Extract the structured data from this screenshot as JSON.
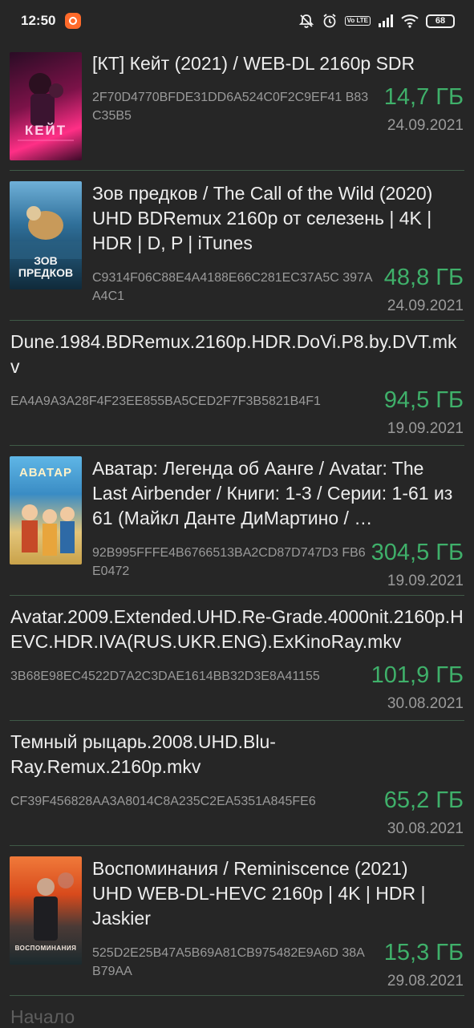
{
  "status": {
    "time": "12:50",
    "battery": "68",
    "volte": "Vo LTE"
  },
  "colors": {
    "size": "#3fb06a",
    "background": "#262626",
    "separator": "#3f5a47"
  },
  "items": [
    {
      "title": "[КТ] Кейт (2021) / WEB-DL 2160p SDR",
      "hash": "2F70D4770BFDE31DD6A524C0F2C9EF41 B83C35B5",
      "size": "14,7 ГБ",
      "date": "24.09.2021",
      "poster_text": "КЕЙТ",
      "poster_colors": [
        "#ff2f86",
        "#3a0a28"
      ]
    },
    {
      "title": "Зов предков / The Call of the Wild (2020) UHD BDRemux 2160p от селезень | 4K | HDR | D, P | iTunes",
      "hash": "C9314F06C88E4A4188E66C281EC37A5C 397AA4C1",
      "size": "48,8 ГБ",
      "date": "24.09.2021",
      "poster_text": "ЗОВ ПРЕДКОВ",
      "poster_colors": [
        "#3f84b6",
        "#102a3a"
      ]
    },
    {
      "title": "Dune.1984.BDRemux.2160p.HDR.DoVi.P8.by.DVT.mkv",
      "hash": "EA4A9A3A28F4F23EE855BA5CED2F7F3B5821B4F1",
      "size": "94,5 ГБ",
      "date": "19.09.2021"
    },
    {
      "title": "Аватар: Легенда об Аанге / Avatar: The Last Airbender / Книги: 1-3 / Серии: 1-61 из 61 (Майкл Данте ДиМартино / …",
      "hash": "92B995FFFE4B6766513BA2CD87D747D3 FB6E0472",
      "size": "304,5 ГБ",
      "date": "19.09.2021",
      "poster_text": "АВАТАР",
      "poster_colors": [
        "#3a8cc4",
        "#c9a24a"
      ]
    },
    {
      "title": "Avatar.2009.Extended.UHD.Re-Grade.4000nit.2160p.HEVC.HDR.IVA(RUS.UKR.ENG).ExKinoRay.mkv",
      "hash": "3B68E98EC4522D7A2C3DAE1614BB32D3E8A41155",
      "size": "101,9 ГБ",
      "date": "30.08.2021"
    },
    {
      "title": "Темный рыцарь.2008.UHD.Blu-Ray.Remux.2160p.mkv",
      "hash": "CF39F456828AA3A8014C8A235C2EA5351A845FE6",
      "size": "65,2 ГБ",
      "date": "30.08.2021"
    },
    {
      "title": "Воспоминания / Reminiscence (2021) UHD WEB-DL-HEVC 2160p | 4K | HDR | Jaskier",
      "hash": "525D2E25B47A5B69A81CB975482E9A6D 38AB79AA",
      "size": "15,3 ГБ",
      "date": "29.08.2021",
      "poster_text": "ВОСПОМИНАНИЯ",
      "poster_colors": [
        "#d84a1c",
        "#1c2a2e"
      ]
    }
  ],
  "footer_label": "Начало"
}
